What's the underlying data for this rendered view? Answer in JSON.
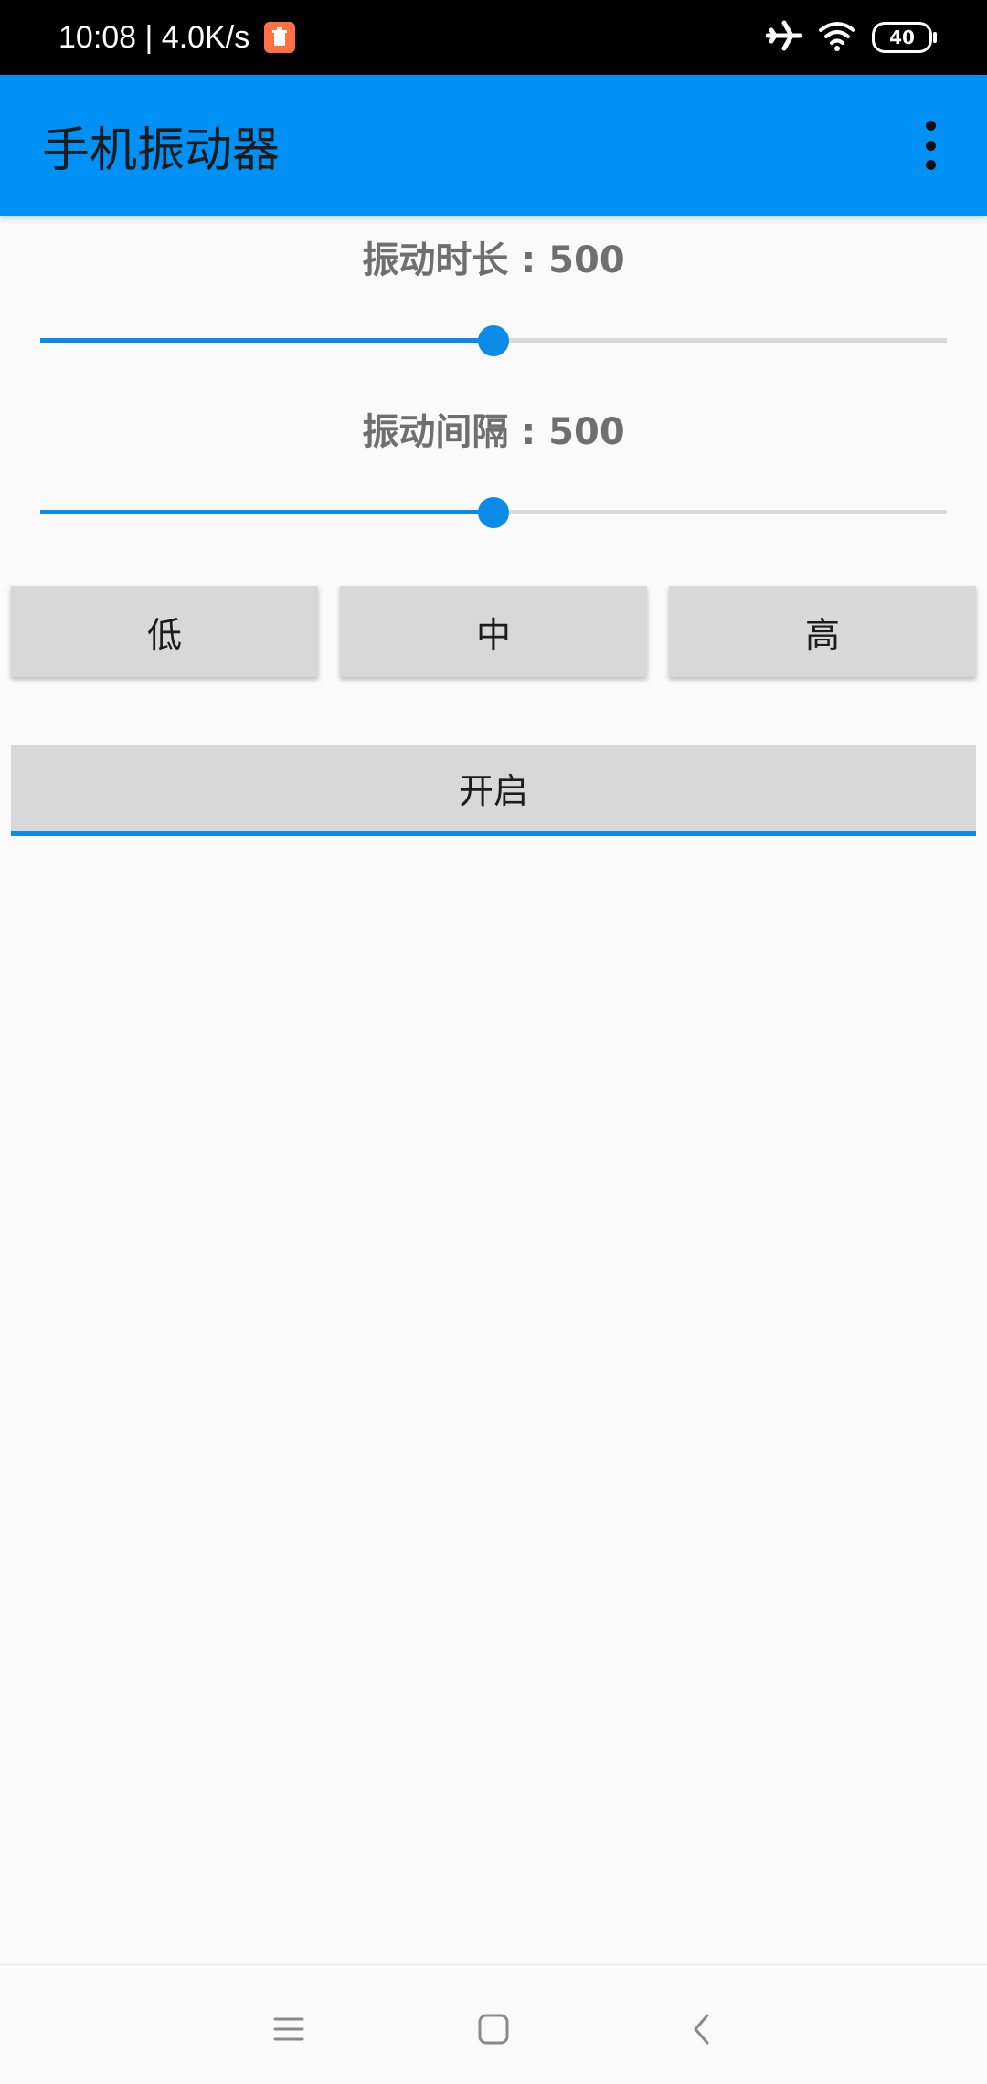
{
  "status_bar": {
    "time_speed": "10:08 | 4.0K/s",
    "battery": "40",
    "icons": [
      "notification-icon",
      "airplane-icon",
      "wifi-icon",
      "battery-icon"
    ]
  },
  "app_bar": {
    "title": "手机振动器",
    "overflow_icon": "more-vert-icon",
    "color": "#0091f6"
  },
  "controls": {
    "duration_label": "振动时长 : 500",
    "duration_value": 0.5,
    "interval_label": "振动间隔 : 500",
    "interval_value": 0.5,
    "accent": "#0b8be8"
  },
  "presets": [
    "低",
    "中",
    "高"
  ],
  "start_button": "开启",
  "nav_bar": {
    "icons": [
      "menu-icon",
      "home-icon",
      "back-icon"
    ]
  }
}
